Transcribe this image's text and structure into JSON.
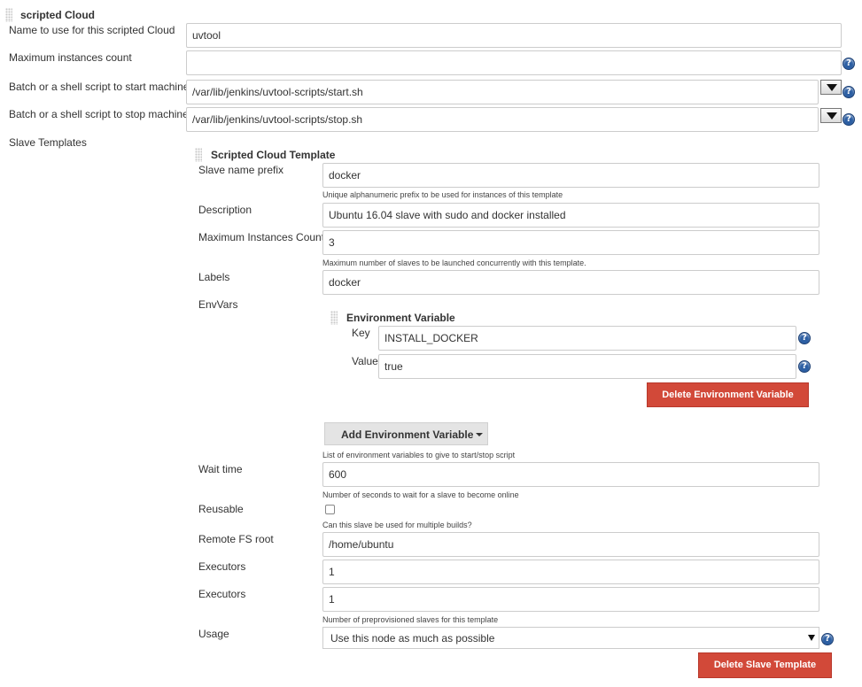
{
  "cloud": {
    "title": "scripted Cloud",
    "name_label": "Name to use for this scripted Cloud",
    "name_value": "uvtool",
    "max_instances_label": "Maximum instances count",
    "max_instances_value": "",
    "start_script_label": "Batch or a shell script to start machine",
    "start_script_value": "/var/lib/jenkins/uvtool-scripts/start.sh",
    "stop_script_label": "Batch or a shell script to stop machine",
    "stop_script_value": "/var/lib/jenkins/uvtool-scripts/stop.sh",
    "slave_templates_label": "Slave Templates"
  },
  "template": {
    "title": "Scripted Cloud Template",
    "prefix_label": "Slave name prefix",
    "prefix_value": "docker",
    "prefix_hint": "Unique alphanumeric prefix to be used for instances of this template",
    "description_label": "Description",
    "description_value": "Ubuntu 16.04 slave with sudo and docker installed",
    "max_count_label": "Maximum Instances Count",
    "max_count_value": "3",
    "max_count_hint": "Maximum number of slaves to be launched concurrently with this template.",
    "labels_label": "Labels",
    "labels_value": "docker",
    "envvars_label": "EnvVars",
    "envvar": {
      "title": "Environment Variable",
      "key_label": "Key",
      "key_value": "INSTALL_DOCKER",
      "value_label": "Value",
      "value_value": "true",
      "delete_label": "Delete Environment Variable"
    },
    "add_env_label": "Add Environment Variable",
    "envvars_hint": "List of environment variables to give to start/stop script",
    "wait_label": "Wait time",
    "wait_value": "600",
    "wait_hint": "Number of seconds to wait for a slave to become online",
    "reusable_label": "Reusable",
    "reusable_hint": "Can this slave be used for multiple builds?",
    "remote_fs_label": "Remote FS root",
    "remote_fs_value": "/home/ubuntu",
    "executors_label": "Executors",
    "executors_value": "1",
    "executors2_label": "Executors",
    "executors2_value": "1",
    "executors2_hint": "Number of preprovisioned slaves for this template",
    "usage_label": "Usage",
    "usage_value": "Use this node as much as possible",
    "delete_template_label": "Delete Slave Template"
  },
  "help_glyph": "?",
  "colors": {
    "danger": "#d24939",
    "help": "#2d5fa3"
  }
}
